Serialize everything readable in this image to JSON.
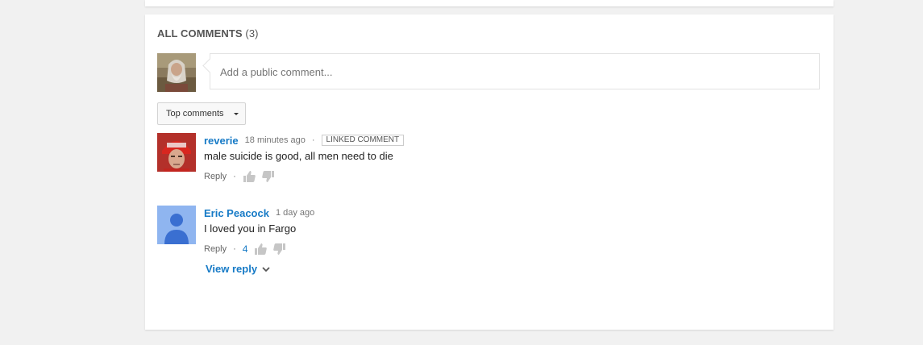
{
  "comments_section": {
    "header_title": "ALL COMMENTS",
    "header_count": "(3)",
    "input_placeholder": "Add a public comment...",
    "sort_label": "Top comments"
  },
  "comments": [
    {
      "author": "reverie",
      "time": "18 minutes ago",
      "separator": "·",
      "badge": "LINKED COMMENT",
      "text": "male suicide is good, all men need to die",
      "reply_label": "Reply",
      "likes": ""
    },
    {
      "author": "Eric Peacock",
      "time": "1 day ago",
      "text": "I loved you in Fargo",
      "reply_label": "Reply",
      "likes": "4",
      "view_reply_label": "View reply"
    }
  ],
  "colors": {
    "link_blue": "#167ac6",
    "background": "#f1f1f1",
    "default_avatar_bg": "#8fb5f0",
    "default_avatar_fg": "#3a6fd1"
  }
}
